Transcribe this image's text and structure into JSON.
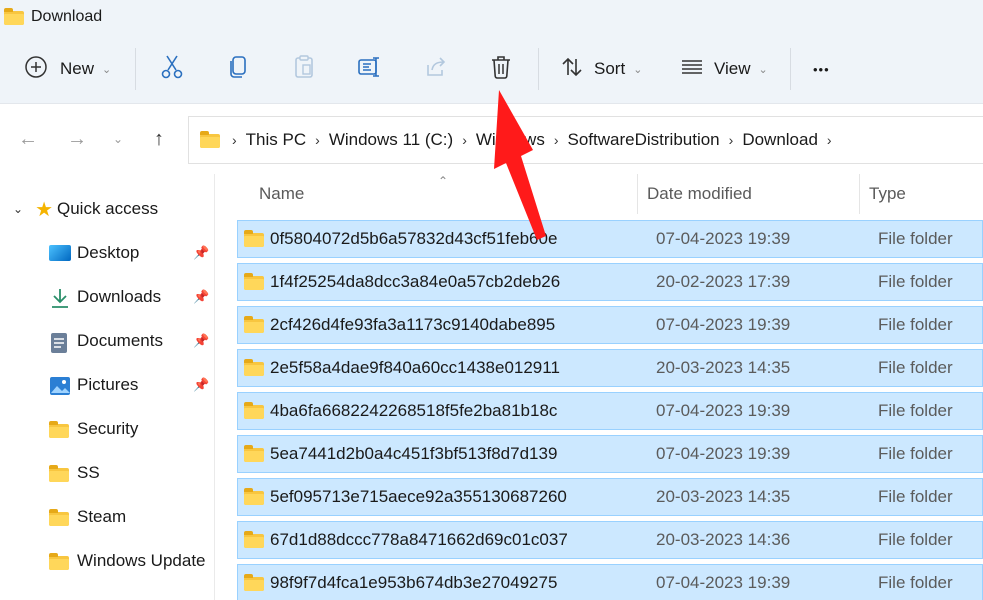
{
  "window": {
    "title": "Download"
  },
  "toolbar": {
    "new_label": "New",
    "sort_label": "Sort",
    "view_label": "View",
    "more_label": "•••"
  },
  "address": {
    "crumbs": [
      "This PC",
      "Windows 11 (C:)",
      "Windows",
      "SoftwareDistribution",
      "Download"
    ]
  },
  "sidebar": {
    "quick_access": "Quick access",
    "items": [
      {
        "label": "Desktop",
        "icon": "desktop-icon",
        "pinned": true
      },
      {
        "label": "Downloads",
        "icon": "download-arrow-icon",
        "pinned": true
      },
      {
        "label": "Documents",
        "icon": "document-icon",
        "pinned": true
      },
      {
        "label": "Pictures",
        "icon": "pictures-icon",
        "pinned": true
      },
      {
        "label": "Security",
        "icon": "folder-icon",
        "pinned": false
      },
      {
        "label": "SS",
        "icon": "folder-icon",
        "pinned": false
      },
      {
        "label": "Steam",
        "icon": "folder-icon",
        "pinned": false
      },
      {
        "label": "Windows Update",
        "icon": "folder-icon",
        "pinned": false
      }
    ]
  },
  "columns": {
    "name": "Name",
    "date": "Date modified",
    "type": "Type"
  },
  "files": [
    {
      "name": "0f5804072d5b6a57832d43cf51feb60e",
      "date": "07-04-2023 19:39",
      "type": "File folder"
    },
    {
      "name": "1f4f25254da8dcc3a84e0a57cb2deb26",
      "date": "20-02-2023 17:39",
      "type": "File folder"
    },
    {
      "name": "2cf426d4fe93fa3a1173c9140dabe895",
      "date": "07-04-2023 19:39",
      "type": "File folder"
    },
    {
      "name": "2e5f58a4dae9f840a60cc1438e012911",
      "date": "20-03-2023 14:35",
      "type": "File folder"
    },
    {
      "name": "4ba6fa6682242268518f5fe2ba81b18c",
      "date": "07-04-2023 19:39",
      "type": "File folder"
    },
    {
      "name": "5ea7441d2b0a4c451f3bf513f8d7d139",
      "date": "07-04-2023 19:39",
      "type": "File folder"
    },
    {
      "name": "5ef095713e715aece92a355130687260",
      "date": "20-03-2023 14:35",
      "type": "File folder"
    },
    {
      "name": "67d1d88dccc778a8471662d69c01c037",
      "date": "20-03-2023 14:36",
      "type": "File folder"
    },
    {
      "name": "98f9f7d4fca1e953b674db3e27049275",
      "date": "07-04-2023 19:39",
      "type": "File folder"
    }
  ],
  "colors": {
    "accent": "#0067c0",
    "selection": "#cce8ff",
    "selection_border": "#99d1ff",
    "annotation_arrow": "#ff0000",
    "folder": "#f8c640"
  }
}
